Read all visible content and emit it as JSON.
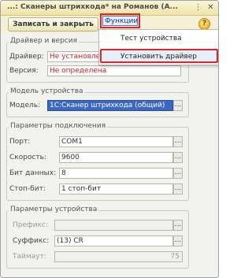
{
  "window": {
    "title": "...: Сканеры штрихкода* на Романов (А...",
    "ctl_more": "⋮",
    "ctl_close": "✕"
  },
  "toolbar": {
    "save_close": "Записать и закрыть",
    "functions": "Функции",
    "functions_arrow": "▾",
    "help": "?"
  },
  "menu": {
    "items": [
      "Тест устройства",
      "Установить драйвер"
    ]
  },
  "driver_group": {
    "title": "Драйвер и версия",
    "driver_label": "Драйвер:",
    "driver_value": "Не установлен",
    "version_label": "Версия:",
    "version_value": "Не определена"
  },
  "model_group": {
    "title": "Модель устройства",
    "model_label": "Модель:",
    "model_value": "1С:Сканер штрихкода (общий)"
  },
  "conn_group": {
    "title": "Параметры подключения",
    "port_label": "Порт:",
    "port_value": "COM1",
    "speed_label": "Скорость:",
    "speed_value": "9600",
    "databits_label": "Бит данных:",
    "databits_value": "8",
    "stopbit_label": "Стоп-бит:",
    "stopbit_value": "1 стоп-бит"
  },
  "device_group": {
    "title": "Параметры устройства",
    "prefix_label": "Префикс:",
    "prefix_value": "",
    "suffix_label": "Суффикс:",
    "suffix_value": "(13) CR",
    "timeout_label": "Таймаут:",
    "timeout_value": "75"
  },
  "dots_label": "...",
  "colors": {
    "accent_red": "#e0252b",
    "selection": "#3a67c4",
    "error_text": "#d42020"
  }
}
